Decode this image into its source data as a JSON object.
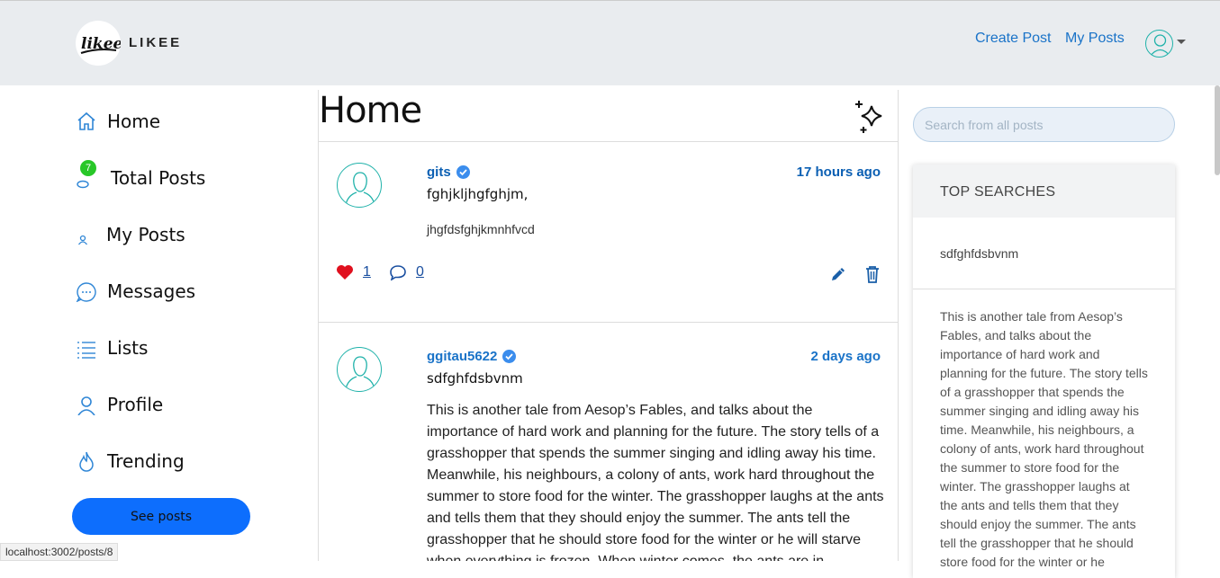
{
  "header": {
    "brand": "LIKEE",
    "logo_text": "likee",
    "nav": [
      "Create Post",
      "My Posts"
    ]
  },
  "sidebar": {
    "items": [
      {
        "label": "Home",
        "icon": "home-icon"
      },
      {
        "label": "Total Posts",
        "icon": "layers-icon",
        "badge": "7"
      },
      {
        "label": "My Posts",
        "icon": "user-small-icon"
      },
      {
        "label": "Messages",
        "icon": "chat-icon"
      },
      {
        "label": "Lists",
        "icon": "list-icon"
      },
      {
        "label": "Profile",
        "icon": "user-icon"
      },
      {
        "label": "Trending",
        "icon": "flame-icon"
      }
    ],
    "button": "See posts"
  },
  "status_url": "localhost:3002/posts/8",
  "feed": {
    "title": "Home",
    "posts": [
      {
        "user": "gits",
        "time": "17 hours ago",
        "title": "fghjkljhgfghjm,",
        "body": "jhgfdsfghjkmnhfvcd",
        "likes": "1",
        "comments": "0"
      },
      {
        "user": "ggitau5622",
        "time": "2 days ago",
        "title": "sdfghfdsbvnm",
        "body": "This is another tale from Aesop’s Fables, and talks about the importance of hard work and planning for the future. The story tells of a grasshopper that spends the summer singing and idling away his time. Meanwhile, his neighbours, a colony of ants, work hard throughout the summer to store food for the winter. The grasshopper laughs at the ants and tells them that they should enjoy the summer. The ants tell the grasshopper that he should store food for the winter or he will starve when everything is frozen. When winter comes, the ants are in"
      }
    ]
  },
  "right": {
    "search_placeholder": "Search from all posts",
    "top_searches_title": "TOP SEARCHES",
    "top_search_item": "sdfghfdsbvnm",
    "excerpt": "This is another tale from Aesop’s Fables, and talks about the importance of hard work and planning for the future. The story tells of a grasshopper that spends the summer singing and idling away his time. Meanwhile, his neighbours, a colony of ants, work hard throughout the summer to store food for the winter. The grasshopper laughs at the ants and tells them that they should enjoy the summer. The ants tell the grasshopper that he should store food for the winter or he"
  },
  "colors": {
    "accent": "#0d6efd",
    "link": "#1a73c8",
    "teal": "#20b2aa",
    "like": "#e0101e",
    "badge": "#28c728"
  }
}
